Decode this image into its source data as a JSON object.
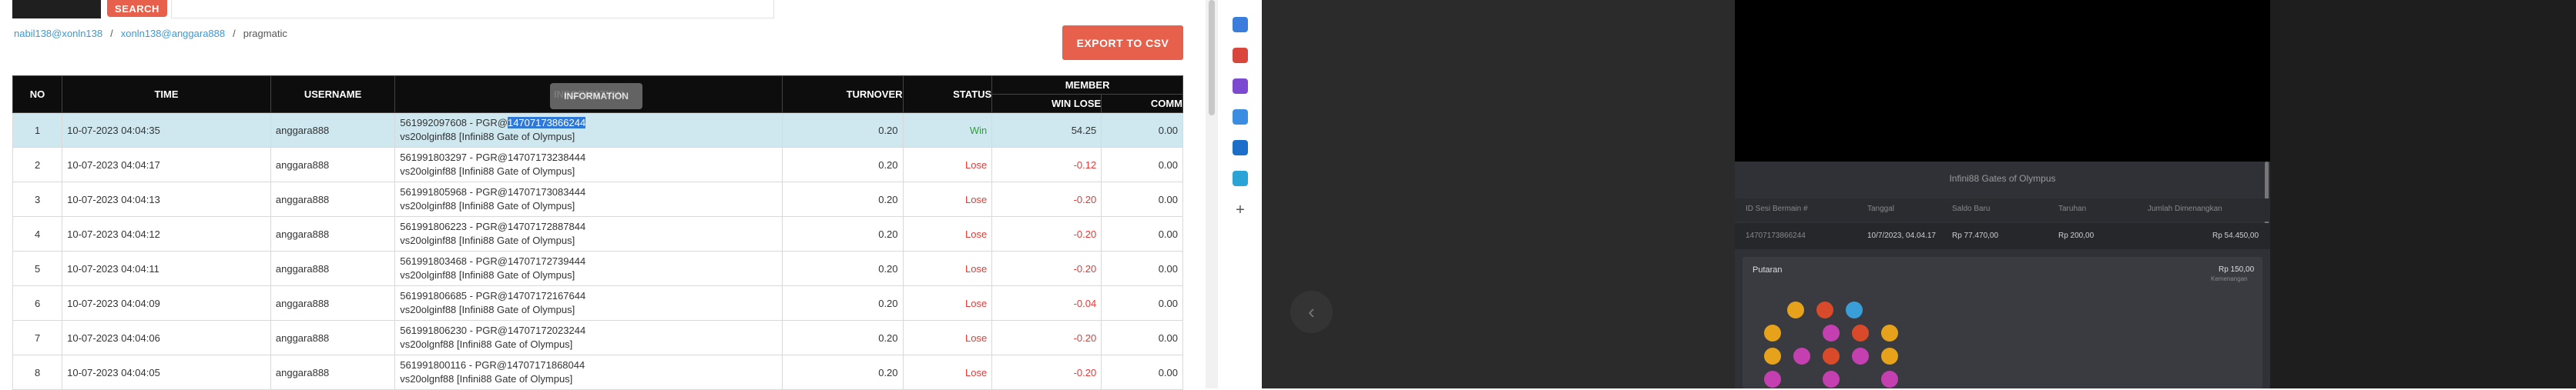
{
  "search": {
    "button_label": "SEARCH"
  },
  "breadcrumb": {
    "crumb1": "nabil138@xonln138",
    "crumb2": "xonln138@anggara888",
    "crumb3": "pragmatic",
    "sep": "/"
  },
  "export": {
    "label": "EXPORT TO CSV"
  },
  "table": {
    "headers": {
      "no": "NO",
      "time": "TIME",
      "username": "USERNAME",
      "information": "INFORMATION",
      "turnover": "TURNOVER",
      "status": "STATUS",
      "member": "MEMBER",
      "win_lose": "WIN LOSE",
      "comm": "COMM"
    },
    "tooltip": "INFORMATION",
    "rows": [
      {
        "no": "1",
        "time": "10-07-2023 04:04:35",
        "username": "anggara888",
        "info1_pre": "561992097608 - PGR@",
        "info1_sel": "14707173866244",
        "info2": "vs20olginf88 [Infini88 Gate of Olympus]",
        "turnover": "0.20",
        "status": "Win",
        "win_lose": "54.25",
        "comm": "0.00"
      },
      {
        "no": "2",
        "time": "10-07-2023 04:04:17",
        "username": "anggara888",
        "info1_pre": "561991803297 - PGR@14707173238444",
        "info1_sel": "",
        "info2": "vs20olginf88 [Infini88 Gate of Olympus]",
        "turnover": "0.20",
        "status": "Lose",
        "win_lose": "-0.12",
        "comm": "0.00"
      },
      {
        "no": "3",
        "time": "10-07-2023 04:04:13",
        "username": "anggara888",
        "info1_pre": "561991805968 - PGR@14707173083444",
        "info1_sel": "",
        "info2": "vs20olginf88 [Infini88 Gate of Olympus]",
        "turnover": "0.20",
        "status": "Lose",
        "win_lose": "-0.20",
        "comm": "0.00"
      },
      {
        "no": "4",
        "time": "10-07-2023 04:04:12",
        "username": "anggara888",
        "info1_pre": "561991806223 - PGR@14707172887844",
        "info1_sel": "",
        "info2": "vs20olginf88 [Infini88 Gate of Olympus]",
        "turnover": "0.20",
        "status": "Lose",
        "win_lose": "-0.20",
        "comm": "0.00"
      },
      {
        "no": "5",
        "time": "10-07-2023 04:04:11",
        "username": "anggara888",
        "info1_pre": "561991803468 - PGR@14707172739444",
        "info1_sel": "",
        "info2": "vs20olginf88 [Infini88 Gate of Olympus]",
        "turnover": "0.20",
        "status": "Lose",
        "win_lose": "-0.20",
        "comm": "0.00"
      },
      {
        "no": "6",
        "time": "10-07-2023 04:04:09",
        "username": "anggara888",
        "info1_pre": "561991806685 - PGR@14707172167644",
        "info1_sel": "",
        "info2": "vs20olginf88 [Infini88 Gate of Olympus]",
        "turnover": "0.20",
        "status": "Lose",
        "win_lose": "-0.04",
        "comm": "0.00"
      },
      {
        "no": "7",
        "time": "10-07-2023 04:04:06",
        "username": "anggara888",
        "info1_pre": "561991806230 - PGR@14707172023244",
        "info1_sel": "",
        "info2": "vs20olgnf88 [Infini88 Gate of Olympus]",
        "turnover": "0.20",
        "status": "Lose",
        "win_lose": "-0.20",
        "comm": "0.00"
      },
      {
        "no": "8",
        "time": "10-07-2023 04:04:05",
        "username": "anggara888",
        "info1_pre": "561991800116 - PGR@14707171868044",
        "info1_sel": "",
        "info2": "vs20olgnf88 [Infini88 Gate of Olympus]",
        "turnover": "0.20",
        "status": "Lose",
        "win_lose": "-0.20",
        "comm": "0.00"
      }
    ]
  },
  "game": {
    "title": "Infini88 Gates of Olympus",
    "headers": {
      "id": "ID Sesi Bermain #",
      "date": "Tanggal",
      "balance": "Saldo Baru",
      "bet": "Taruhan",
      "total": "Jumlah Dimenangkan"
    },
    "row": {
      "id": "14707173866244",
      "date": "10/7/2023, 04.04.17",
      "balance": "Rp 77.470,00",
      "bet": "Rp 200,00",
      "total": "Rp 54.450,00"
    },
    "spin_label": "Putaran",
    "spin_amount": "Rp 150,00",
    "spin_sub": "Kemenangan",
    "gem_colors": [
      "#e6a21a",
      "#c43fb0",
      "#d84a2a",
      "#3a9fd9"
    ]
  },
  "extensions": [
    {
      "name": "tag-icon",
      "color": "#3b7ddd"
    },
    {
      "name": "gift-icon",
      "color": "#d9463b"
    },
    {
      "name": "user-group-icon",
      "color": "#7b4ad1"
    },
    {
      "name": "chrome-icon",
      "color": "#3a8de0"
    },
    {
      "name": "outlook-icon",
      "color": "#1b6fc9"
    },
    {
      "name": "cart-icon",
      "color": "#2aa3d6"
    }
  ]
}
